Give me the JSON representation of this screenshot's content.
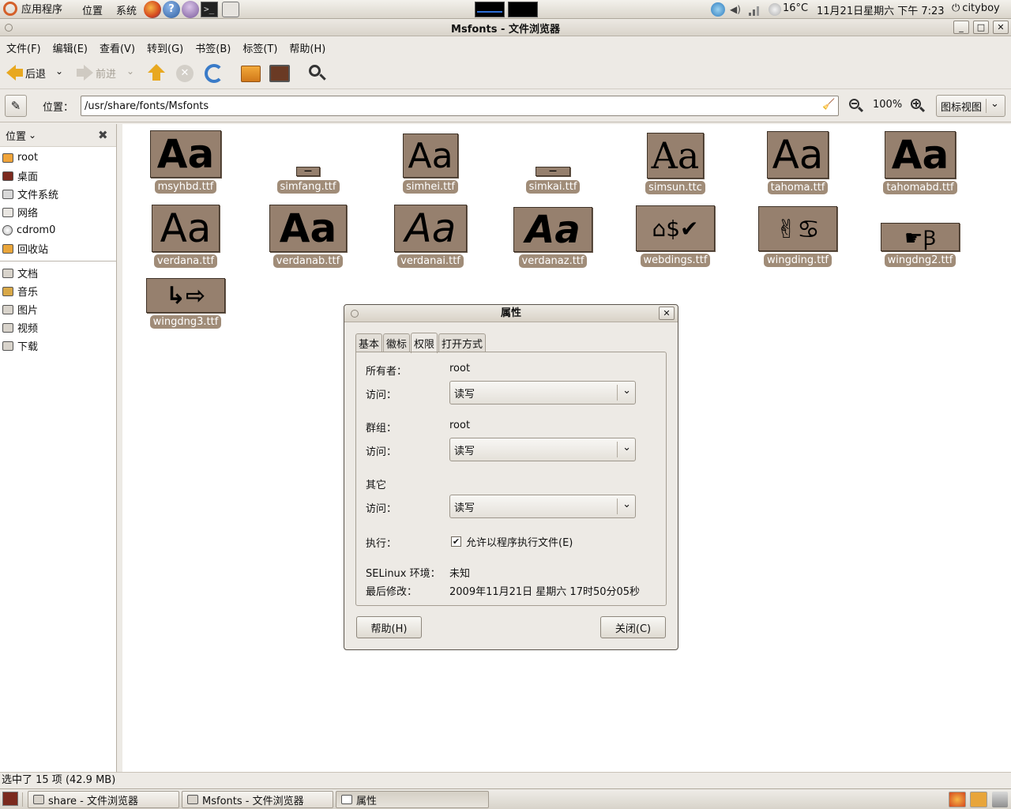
{
  "top_panel": {
    "menus": [
      "应用程序",
      "位置",
      "系统"
    ],
    "temperature": "16°C",
    "datetime": "11月21日星期六 下午 7:23",
    "user": "cityboy"
  },
  "window": {
    "title": "Msfonts - 文件浏览器"
  },
  "menubar": [
    "文件(F)",
    "编辑(E)",
    "查看(V)",
    "转到(G)",
    "书签(B)",
    "标签(T)",
    "帮助(H)"
  ],
  "toolbar": {
    "back_label": "后退",
    "forward_label": "前进"
  },
  "location": {
    "label": "位置：",
    "path": "/usr/share/fonts/Msfonts",
    "zoom": "100%",
    "view_mode": "图标视图"
  },
  "sidebar": {
    "header": "位置",
    "items": [
      "root",
      "桌面",
      "文件系统",
      "网络",
      "cdrom0",
      "回收站"
    ],
    "bookmarks": [
      "文档",
      "音乐",
      "图片",
      "视频",
      "下载"
    ]
  },
  "files": [
    {
      "name": "msyhbd.ttf",
      "preview": "Aa"
    },
    {
      "name": "simfang.ttf",
      "preview": "—"
    },
    {
      "name": "simhei.ttf",
      "preview": "Aa"
    },
    {
      "name": "simkai.ttf",
      "preview": "—"
    },
    {
      "name": "simsun.ttc",
      "preview": "Aa"
    },
    {
      "name": "tahoma.ttf",
      "preview": "Aa"
    },
    {
      "name": "tahomabd.ttf",
      "preview": "Aa"
    },
    {
      "name": "verdana.ttf",
      "preview": "Aa"
    },
    {
      "name": "verdanab.ttf",
      "preview": "Aa"
    },
    {
      "name": "verdanai.ttf",
      "preview": "Aa"
    },
    {
      "name": "verdanaz.ttf",
      "preview": "Aa"
    },
    {
      "name": "webdings.ttf",
      "preview": "⌂$✔"
    },
    {
      "name": "wingding.ttf",
      "preview": "✌♋"
    },
    {
      "name": "wingdng2.ttf",
      "preview": "☛Ꞵ"
    },
    {
      "name": "wingdng3.ttf",
      "preview": "↳⇨"
    }
  ],
  "status": "选中了 15 项 (42.9 MB)",
  "taskbar": [
    "share - 文件浏览器",
    "Msfonts - 文件浏览器",
    "属性"
  ],
  "dialog": {
    "title": "属性",
    "tabs": [
      "基本",
      "徽标",
      "权限",
      "打开方式"
    ],
    "selected_tab": "权限",
    "owner_label": "所有者：",
    "owner": "root",
    "access_label": "访问：",
    "owner_access": "读写",
    "group_label": "群组：",
    "group": "root",
    "group_access": "读写",
    "others_label": "其它",
    "others_access": "读写",
    "exec_label": "执行：",
    "exec_checkbox": "允许以程序执行文件(E)",
    "exec_checked": true,
    "selinux_label": "SELinux 环境：",
    "selinux": "未知",
    "modified_label": "最后修改：",
    "modified": "2009年11月21日 星期六 17时50分05秒",
    "help_button": "帮助(H)",
    "close_button": "关闭(C)"
  }
}
